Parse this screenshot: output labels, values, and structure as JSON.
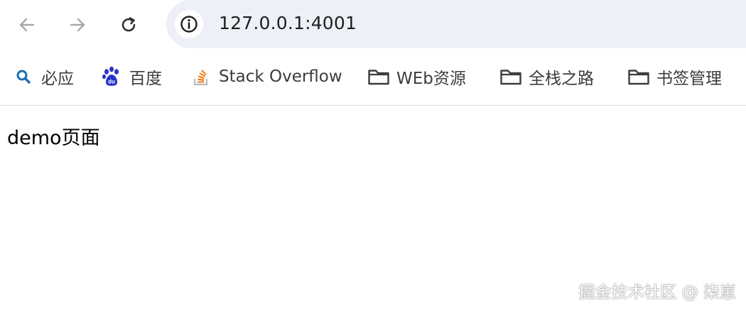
{
  "toolbar": {
    "back_icon": "back-arrow-icon",
    "forward_icon": "forward-arrow-icon",
    "reload_icon": "reload-icon",
    "site_info_icon": "info-circle-icon",
    "url": "127.0.0.1:4001"
  },
  "bookmarks": [
    {
      "label": "必应",
      "icon": "bing-search-icon"
    },
    {
      "label": "百度",
      "icon": "baidu-paw-icon"
    },
    {
      "label": "Stack Overflow",
      "icon": "stackoverflow-icon"
    },
    {
      "label": "WEb资源",
      "icon": "folder-icon"
    },
    {
      "label": "全栈之路",
      "icon": "folder-icon"
    },
    {
      "label": "书签管理",
      "icon": "folder-icon"
    }
  ],
  "page": {
    "text": "demo页面"
  },
  "watermark": "掘金技术社区 @ 柒崽",
  "colors": {
    "omnibox_bg": "#eef0f7",
    "baidu_blue": "#2a33c8",
    "stackoverflow_orange": "#f48024",
    "bing_blue": "#1a6fb5"
  }
}
